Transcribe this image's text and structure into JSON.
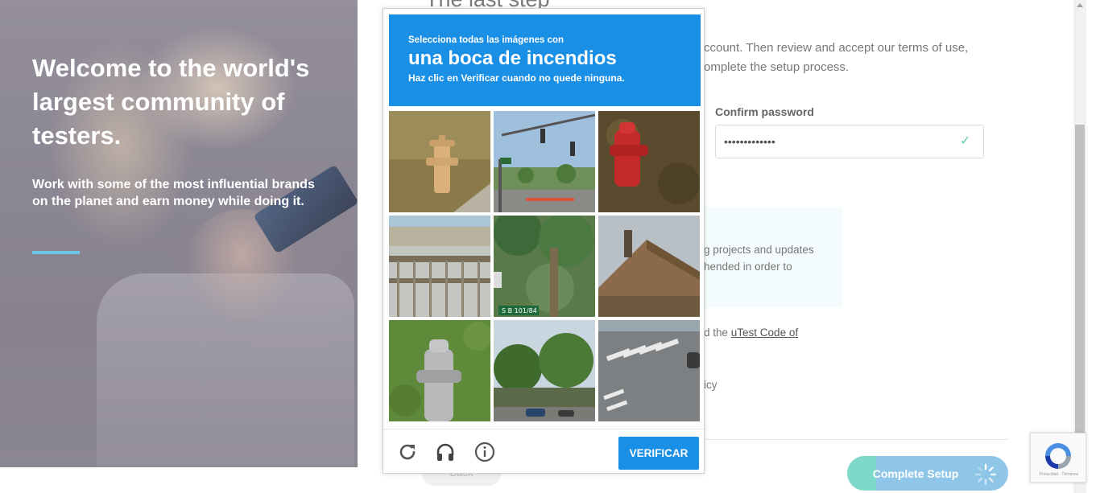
{
  "hero": {
    "title": "Welcome to the world's largest community of testers.",
    "subtitle": "Work with some of the most influential brands on the planet and earn money while doing it."
  },
  "form": {
    "step_title": "The last step",
    "intro": "ccount. Then review and accept our terms of use, omplete the setup process.",
    "confirm_password_label": "Confirm password",
    "confirm_password_value": "•••••••••••••",
    "info_text": "g projects and updates hended in order to",
    "code_prefix": "d the ",
    "code_link": "uTest Code of",
    "policy_text": "icy",
    "back_label": "Back",
    "complete_label": "Complete Setup"
  },
  "captcha": {
    "line1": "Selecciona todas las imágenes con",
    "line2": "una boca de incendios",
    "line3": "Haz clic en Verificar cuando no quede ninguna.",
    "verify_label": "VERIFICAR",
    "tiles": [
      "tan fire hydrant on grass",
      "traffic lights and palm trees",
      "red fire hydrant",
      "bridge railing",
      "palm tree and street sign",
      "house roof with chimney",
      "silver fire hydrant",
      "trees and parked cars",
      "crosswalk intersection"
    ],
    "tile_sign_text": "S B 101/84",
    "icons": [
      "reload-icon",
      "audio-headphones-icon",
      "info-icon"
    ]
  },
  "recaptcha_badge": {
    "terms": "Privacidad - Términos"
  },
  "colors": {
    "captcha_blue": "#1a8fe6",
    "hero_accent": "#6ec6e6",
    "complete_button": "#8fc6e8",
    "check_green": "#5fd0a0"
  }
}
